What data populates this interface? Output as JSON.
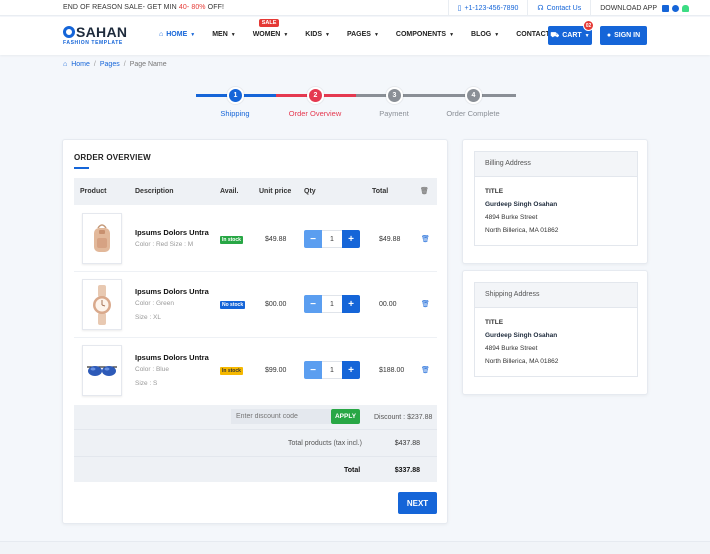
{
  "topbar": {
    "promo_prefix": "END OF REASON SALE- GET MIN ",
    "promo_highlight": "40- 80%",
    "promo_suffix": " OFF!",
    "phone": "+1-123-456-7890",
    "contact": "Contact Us",
    "download": "DOWNLOAD APP"
  },
  "logo": {
    "brand": "SAHAN",
    "tagline": "FASHION TEMPLATE"
  },
  "nav": {
    "items": [
      "HOME",
      "MEN",
      "WOMEN",
      "KIDS",
      "PAGES",
      "COMPONENTS",
      "BLOG",
      "CONTACT"
    ],
    "sale_badge": "SALE"
  },
  "header": {
    "cart_label": "CART",
    "cart_count": "02",
    "signin_label": "SIGN IN"
  },
  "breadcrumb": {
    "home": "Home",
    "pages": "Pages",
    "current": "Page Name"
  },
  "steps": [
    {
      "num": "1",
      "label": "Shipping",
      "color": "#1565d8"
    },
    {
      "num": "2",
      "label": "Order Overview",
      "color": "#e53950"
    },
    {
      "num": "3",
      "label": "Payment",
      "color": "#8a8f96"
    },
    {
      "num": "4",
      "label": "Order Complete",
      "color": "#8a8f96"
    }
  ],
  "order": {
    "title": "ORDER OVERVIEW",
    "headers": [
      "Product",
      "Description",
      "Avail.",
      "Unit price",
      "Qty",
      "Total"
    ],
    "items": [
      {
        "name": "Ipsums Dolors Untra",
        "meta1": "Color : Red Size : M",
        "meta2": "",
        "avail": "In stock",
        "avail_color": "#28a745",
        "price": "$49.88",
        "qty": "1",
        "total": "$49.88",
        "icon": "backpack-icon"
      },
      {
        "name": "Ipsums Dolors Untra",
        "meta1": "Color : Green",
        "meta2": "Size : XL",
        "avail": "No stock",
        "avail_color": "#1565d8",
        "price": "$00.00",
        "qty": "1",
        "total": "00.00",
        "icon": "watch-icon"
      },
      {
        "name": "Ipsums Dolors Untra",
        "meta1": "Color : Blue",
        "meta2": "Size : S",
        "avail": "In stock",
        "avail_color": "#f5b800",
        "price": "$99.00",
        "qty": "1",
        "total": "$188.00",
        "icon": "sunglasses-icon"
      }
    ],
    "discount_placeholder": "Enter discount code",
    "apply_label": "APPLY",
    "discount_text": "Discount : $237.88",
    "total_products_label": "Total products (tax incl.)",
    "total_products_value": "$437.88",
    "total_label": "Total",
    "total_value": "$337.88",
    "next_label": "NEXT"
  },
  "billing": {
    "head": "Billing Address",
    "title": "TITLE",
    "name": "Gurdeep Singh Osahan",
    "line1": "4894 Burke Street",
    "line2": "North Billerica, MA 01862"
  },
  "shipping": {
    "head": "Shipping Address",
    "title": "TITLE",
    "name": "Gurdeep Singh Osahan",
    "line1": "4894 Burke Street",
    "line2": "North Billerica, MA 01862"
  }
}
